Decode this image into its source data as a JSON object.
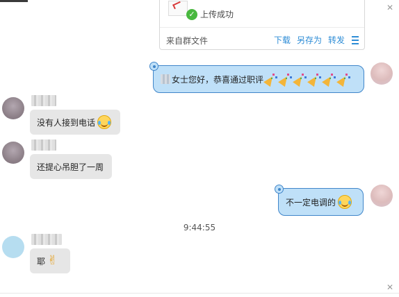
{
  "file_card": {
    "status": "上传成功",
    "source": "来自群文件",
    "actions": [
      "下载",
      "另存为",
      "转发"
    ]
  },
  "messages": {
    "outgoing_1": "女士您好，恭喜通过职评",
    "incoming_1": "没有人接到电话",
    "incoming_2": "还提心吊胆了一周",
    "outgoing_2": "不一定电调的",
    "incoming_3": "耶"
  },
  "timestamp": "9:44:55",
  "icons": {
    "close": "close-icon",
    "check": "check-icon",
    "menu": "menu-icon",
    "laugh_cry": "laugh-cry-emoji-icon",
    "party": "party-popper-icon",
    "victory": "victory-hand-icon"
  }
}
